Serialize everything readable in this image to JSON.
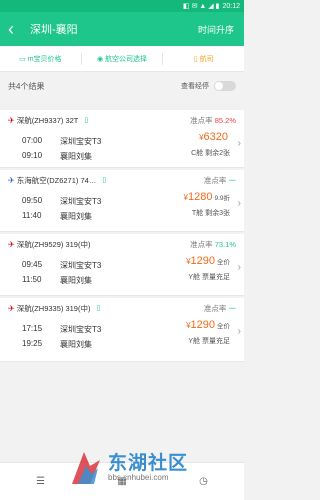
{
  "status_bar": {
    "icons": "◧ ✉ ▲ ◢ ▮",
    "time": "20:12"
  },
  "header": {
    "back_icon": "back-arrow",
    "title": "深圳-襄阳",
    "sort_label": "时间升序"
  },
  "filters": [
    {
      "icon": "▭",
      "label": "m宝贝价格"
    },
    {
      "icon": "◉",
      "label": "航空公司选择"
    },
    {
      "icon": "▯",
      "label": "航司"
    }
  ],
  "result_count": "共4个结果",
  "direct_toggle_label": "查看经停",
  "flights": [
    {
      "airline_icon": "✈",
      "flight_no": "深航(ZH9337) 32T",
      "phone_icon": "▯",
      "ontime_label": "准点率",
      "ontime_value": "85.2%",
      "dep_time": "07:00",
      "dep_airport": "深圳宝安T3",
      "arr_time": "09:10",
      "arr_airport": "襄阳刘集",
      "price_symbol": "¥",
      "price": "6320",
      "discount": "",
      "cabin": "C舱 剩余2张"
    },
    {
      "airline_icon": "✈",
      "flight_no": "东海航空(DZ6271) 74…",
      "phone_icon": "▯",
      "ontime_label": "准点率",
      "ontime_value": "一",
      "dep_time": "09:50",
      "dep_airport": "深圳宝安T3",
      "arr_time": "11:40",
      "arr_airport": "襄阳刘集",
      "price_symbol": "¥",
      "price": "1280",
      "discount": "9.9折",
      "cabin": "T舱 剩余3张"
    },
    {
      "airline_icon": "✈",
      "flight_no": "深航(ZH9529) 319(中)",
      "phone_icon": "",
      "ontime_label": "准点率",
      "ontime_value": "73.1%",
      "dep_time": "09:45",
      "dep_airport": "深圳宝安T3",
      "arr_time": "11:50",
      "arr_airport": "襄阳刘集",
      "price_symbol": "¥",
      "price": "1290",
      "discount": "全价",
      "cabin": "Y舱 票量充足"
    },
    {
      "airline_icon": "✈",
      "flight_no": "深航(ZH9335) 319(中)",
      "phone_icon": "▯",
      "ontime_label": "准点率",
      "ontime_value": "一",
      "dep_time": "17:15",
      "dep_airport": "深圳宝安T3",
      "arr_time": "19:25",
      "arr_airport": "襄阳刘集",
      "price_symbol": "¥",
      "price": "1290",
      "discount": "全价",
      "cabin": "Y舱 票量充足"
    }
  ],
  "watermark": {
    "brand": "东湖社区",
    "url": "bbs.cnhubei.com"
  },
  "colors": {
    "primary": "#1fc68b",
    "price": "#f06a1c",
    "ontime_bad": "#e64545"
  }
}
